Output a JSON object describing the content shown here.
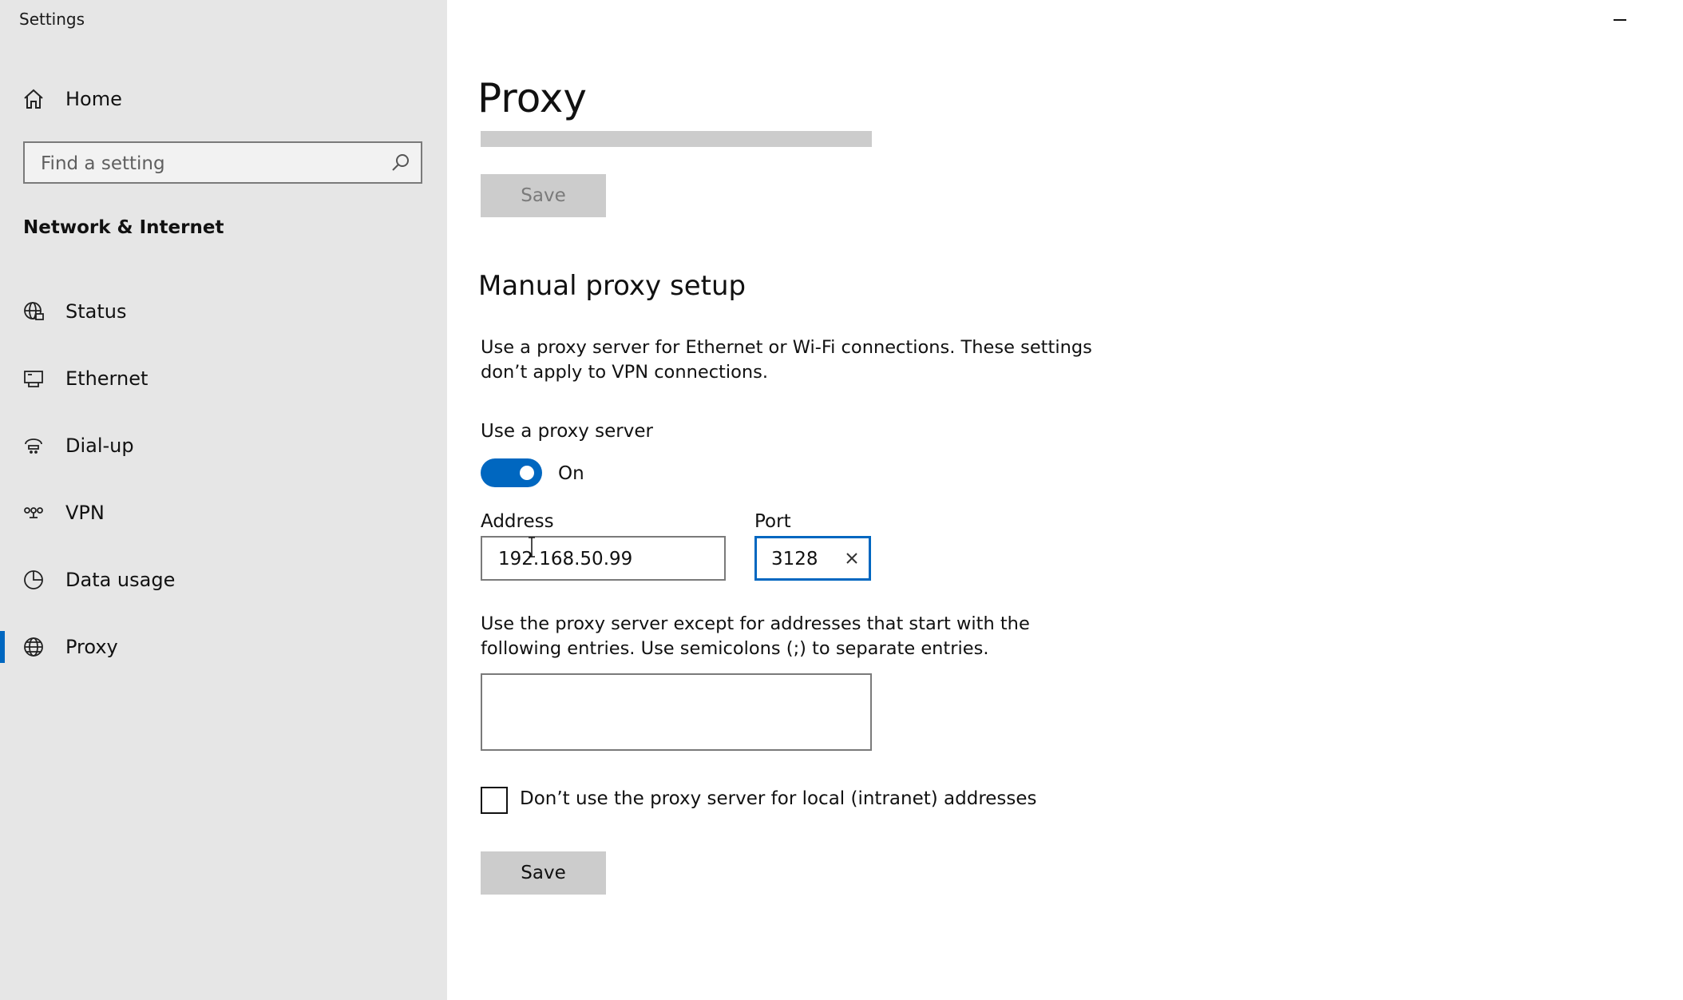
{
  "window": {
    "title": "Settings"
  },
  "sidebar": {
    "home_label": "Home",
    "search_placeholder": "Find a setting",
    "section_title": "Network & Internet",
    "items": [
      {
        "label": "Status",
        "icon": "globe-network-icon"
      },
      {
        "label": "Ethernet",
        "icon": "ethernet-icon"
      },
      {
        "label": "Dial-up",
        "icon": "dial-up-icon"
      },
      {
        "label": "VPN",
        "icon": "vpn-icon"
      },
      {
        "label": "Data usage",
        "icon": "data-usage-icon"
      },
      {
        "label": "Proxy",
        "icon": "globe-icon",
        "active": true
      }
    ]
  },
  "main": {
    "page_title": "Proxy",
    "top_save_label": "Save",
    "manual_heading": "Manual proxy setup",
    "manual_description": "Use a proxy server for Ethernet or Wi-Fi connections. These settings don’t apply to VPN connections.",
    "use_proxy_label": "Use a proxy server",
    "toggle_state": "On",
    "address_label": "Address",
    "address_value": "192.168.50.99",
    "port_label": "Port",
    "port_value": "3128",
    "exceptions_description": "Use the proxy server except for addresses that start with the following entries. Use semicolons (;) to separate entries.",
    "exceptions_value": "",
    "local_checkbox_label": "Don’t use the proxy server for local (intranet) addresses",
    "local_checkbox_checked": false,
    "save_label": "Save"
  },
  "colors": {
    "accent": "#0067c0",
    "sidebar_bg": "#e6e6e6",
    "button_bg": "#cccccc"
  }
}
